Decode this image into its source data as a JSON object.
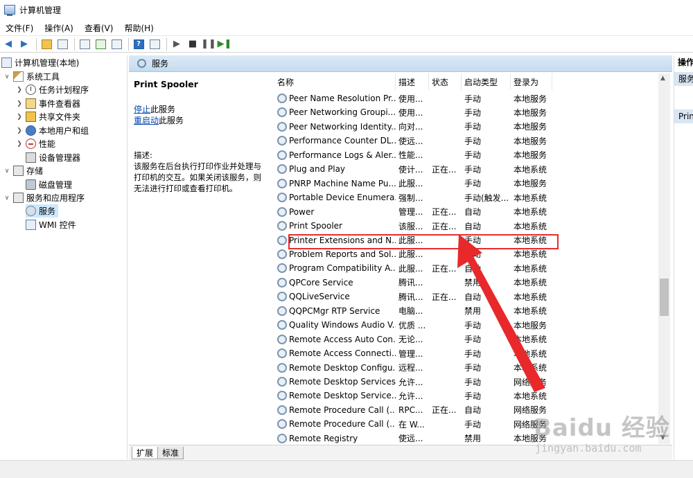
{
  "window": {
    "title": "计算机管理"
  },
  "menu": [
    "文件(F)",
    "操作(A)",
    "查看(V)",
    "帮助(H)"
  ],
  "tree": {
    "root": "计算机管理(本地)",
    "system_tools": "系统工具",
    "task_scheduler": "任务计划程序",
    "event_viewer": "事件查看器",
    "shared_folders": "共享文件夹",
    "local_users": "本地用户和组",
    "performance": "性能",
    "device_manager": "设备管理器",
    "storage": "存储",
    "disk_management": "磁盘管理",
    "services_apps": "服务和应用程序",
    "services": "服务",
    "wmi": "WMI 控件"
  },
  "panel": {
    "header": "服务",
    "selected_service": "Print Spooler",
    "stop_link": "停止",
    "stop_suffix": "此服务",
    "restart_link": "重启动",
    "restart_suffix": "此服务",
    "desc_label": "描述:",
    "desc_text": "该服务在后台执行打印作业并处理与打印机的交互。如果关闭该服务，则无法进行打印或查看打印机。"
  },
  "columns": {
    "name": "名称",
    "desc": "描述",
    "status": "状态",
    "startup": "启动类型",
    "logon": "登录为"
  },
  "services": [
    {
      "name": "Peer Name Resolution Pr...",
      "desc": "使用...",
      "status": "",
      "startup": "手动",
      "logon": "本地服务"
    },
    {
      "name": "Peer Networking Groupi...",
      "desc": "使用...",
      "status": "",
      "startup": "手动",
      "logon": "本地服务"
    },
    {
      "name": "Peer Networking Identity...",
      "desc": "向对...",
      "status": "",
      "startup": "手动",
      "logon": "本地服务"
    },
    {
      "name": "Performance Counter DL...",
      "desc": "使远...",
      "status": "",
      "startup": "手动",
      "logon": "本地服务"
    },
    {
      "name": "Performance Logs & Aler...",
      "desc": "性能...",
      "status": "",
      "startup": "手动",
      "logon": "本地服务"
    },
    {
      "name": "Plug and Play",
      "desc": "使计...",
      "status": "正在...",
      "startup": "手动",
      "logon": "本地系统"
    },
    {
      "name": "PNRP Machine Name Pu...",
      "desc": "此服...",
      "status": "",
      "startup": "手动",
      "logon": "本地服务"
    },
    {
      "name": "Portable Device Enumera...",
      "desc": "强制...",
      "status": "",
      "startup": "手动(触发...",
      "logon": "本地系统"
    },
    {
      "name": "Power",
      "desc": "管理...",
      "status": "正在...",
      "startup": "自动",
      "logon": "本地系统"
    },
    {
      "name": "Print Spooler",
      "desc": "该服...",
      "status": "正在...",
      "startup": "自动",
      "logon": "本地系统"
    },
    {
      "name": "Printer Extensions and N...",
      "desc": "此服...",
      "status": "",
      "startup": "手动",
      "logon": "本地系统"
    },
    {
      "name": "Problem Reports and Sol...",
      "desc": "此服...",
      "status": "",
      "startup": "手动",
      "logon": "本地系统"
    },
    {
      "name": "Program Compatibility A...",
      "desc": "此服...",
      "status": "正在...",
      "startup": "自动",
      "logon": "本地系统"
    },
    {
      "name": "QPCore Service",
      "desc": "腾讯...",
      "status": "",
      "startup": "禁用",
      "logon": "本地系统"
    },
    {
      "name": "QQLiveService",
      "desc": "腾讯...",
      "status": "正在...",
      "startup": "自动",
      "logon": "本地系统"
    },
    {
      "name": "QQPCMgr RTP Service",
      "desc": "电脑...",
      "status": "",
      "startup": "禁用",
      "logon": "本地系统"
    },
    {
      "name": "Quality Windows Audio V...",
      "desc": "优质 ...",
      "status": "",
      "startup": "手动",
      "logon": "本地服务"
    },
    {
      "name": "Remote Access Auto Con...",
      "desc": "无论...",
      "status": "",
      "startup": "手动",
      "logon": "本地系统"
    },
    {
      "name": "Remote Access Connecti...",
      "desc": "管理...",
      "status": "",
      "startup": "手动",
      "logon": "本地系统"
    },
    {
      "name": "Remote Desktop Configu...",
      "desc": "远程...",
      "status": "",
      "startup": "手动",
      "logon": "本地系统"
    },
    {
      "name": "Remote Desktop Services",
      "desc": "允许...",
      "status": "",
      "startup": "手动",
      "logon": "网络服务"
    },
    {
      "name": "Remote Desktop Service...",
      "desc": "允许...",
      "status": "",
      "startup": "手动",
      "logon": "本地系统"
    },
    {
      "name": "Remote Procedure Call (...",
      "desc": "RPC...",
      "status": "正在...",
      "startup": "自动",
      "logon": "网络服务"
    },
    {
      "name": "Remote Procedure Call (...",
      "desc": "在 W...",
      "status": "",
      "startup": "手动",
      "logon": "网络服务"
    },
    {
      "name": "Remote Registry",
      "desc": "使远...",
      "status": "",
      "startup": "禁用",
      "logon": "本地服务"
    }
  ],
  "tabs": [
    "扩展",
    "标准"
  ],
  "actions": {
    "header": "操作",
    "item1": "服务",
    "item2": "Print Spooler"
  },
  "watermark": {
    "main": "Baidu 经验",
    "sub": "jingyan.baidu.com"
  },
  "colors": {
    "highlight_box": "#e82a2a",
    "arrow": "#e8282a",
    "header_bg": "#c6dbef"
  }
}
